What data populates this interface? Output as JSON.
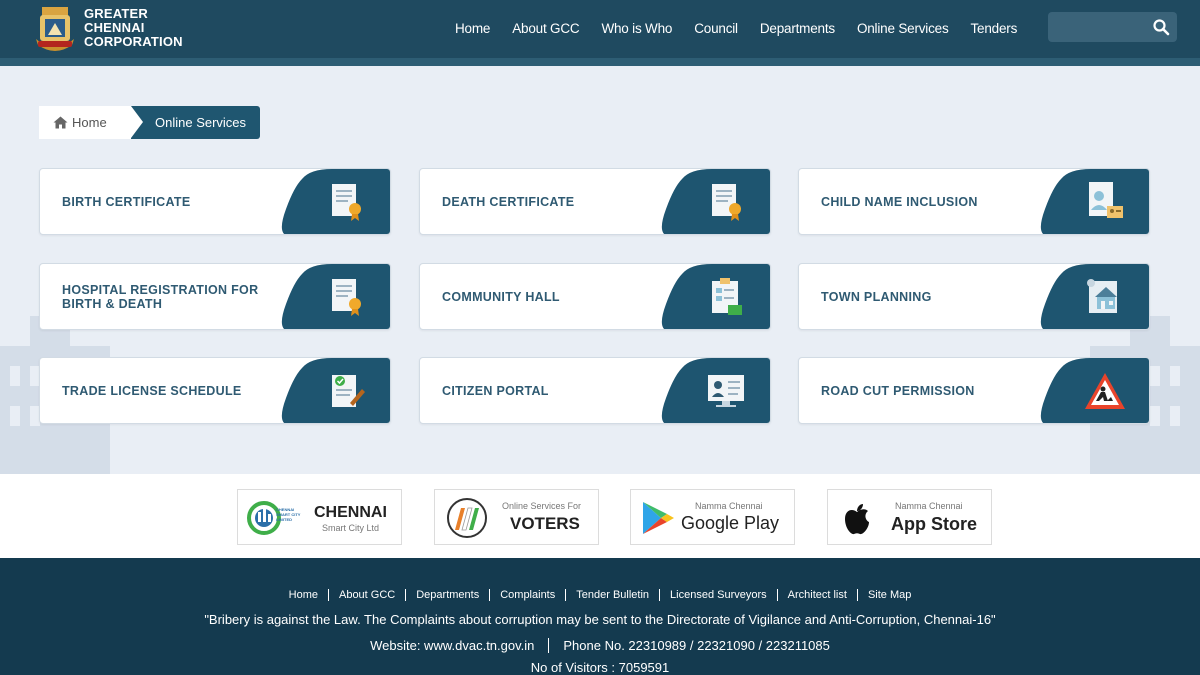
{
  "header": {
    "brand_lines": [
      "GREATER",
      "CHENNAI",
      "CORPORATION"
    ],
    "nav": [
      "Home",
      "About GCC",
      "Who is Who",
      "Council",
      "Departments",
      "Online Services",
      "Tenders"
    ],
    "search": {
      "placeholder": ""
    }
  },
  "breadcrumb": {
    "home": "Home",
    "current": "Online Services"
  },
  "services": [
    {
      "label": "BIRTH CERTIFICATE",
      "icon": "certificate-icon"
    },
    {
      "label": "DEATH CERTIFICATE",
      "icon": "certificate-icon"
    },
    {
      "label": "CHILD NAME INCLUSION",
      "icon": "child-id-icon"
    },
    {
      "label": "HOSPITAL REGISTRATION FOR BIRTH & DEATH",
      "icon": "certificate-icon"
    },
    {
      "label": "COMMUNITY HALL",
      "icon": "clipboard-icon"
    },
    {
      "label": "TOWN PLANNING",
      "icon": "blueprint-icon"
    },
    {
      "label": "TRADE LICENSE SCHEDULE",
      "icon": "license-icon"
    },
    {
      "label": "CITIZEN PORTAL",
      "icon": "portal-icon"
    },
    {
      "label": "ROAD CUT PERMISSION",
      "icon": "road-work-icon"
    }
  ],
  "partners": {
    "smart_city": {
      "title": "CHENNAI",
      "sub": "Smart City Ltd",
      "logo_text": "CHENNAI SMART CITY LIMITED"
    },
    "voters": {
      "sub": "Online Services For",
      "title": "VOTERS"
    },
    "google_play": {
      "sub": "Namma Chennai",
      "title": "Google Play"
    },
    "app_store": {
      "sub": "Namma Chennai",
      "title": "App Store"
    }
  },
  "footer": {
    "links": [
      "Home",
      "About GCC",
      "Departments",
      "Complaints",
      "Tender Bulletin",
      "Licensed Surveyors",
      "Architect list",
      "Site Map"
    ],
    "notice": "\"Bribery is against the Law. The Complaints about corruption may be sent to the Directorate of Vigilance and Anti-Corruption, Chennai-16\"",
    "website": "Website: www.dvac.tn.gov.in",
    "phone": "Phone No. 22310989 / 22321090 / 223211085",
    "visitors": "No of Visitors : 7059591"
  },
  "colors": {
    "header": "#1f4a60",
    "accent": "#1f5670",
    "footer": "#143a4f",
    "card_text": "#2f5a72"
  }
}
